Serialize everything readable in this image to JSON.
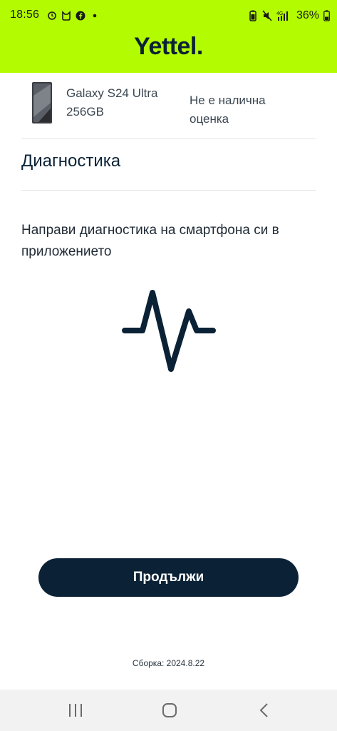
{
  "status_bar": {
    "time": "18:56",
    "battery": "36%",
    "network": "4G",
    "left_icons": [
      "alarm-icon",
      "cat-icon",
      "facebook-icon",
      "dot-icon"
    ],
    "right_icons": [
      "battery-saver-icon",
      "mute-icon",
      "signal-icon",
      "battery-icon"
    ]
  },
  "header": {
    "brand": "Yettel.",
    "brand_color": "#b3fb00"
  },
  "device": {
    "name": "Galaxy S24 Ultra 256GB",
    "rating": "Не е налична оценка"
  },
  "section": {
    "title": "Диагностика"
  },
  "main": {
    "description": "Направи диагностика на смартфона си в приложението",
    "icon": "pulse-icon"
  },
  "actions": {
    "continue_label": "Продължи"
  },
  "footer": {
    "build": "Сборка: 2024.8.22"
  },
  "nav": {
    "items": [
      "recent-apps-icon",
      "home-icon",
      "back-icon"
    ]
  },
  "colors": {
    "accent": "#b3fb00",
    "primary": "#0b2236"
  }
}
